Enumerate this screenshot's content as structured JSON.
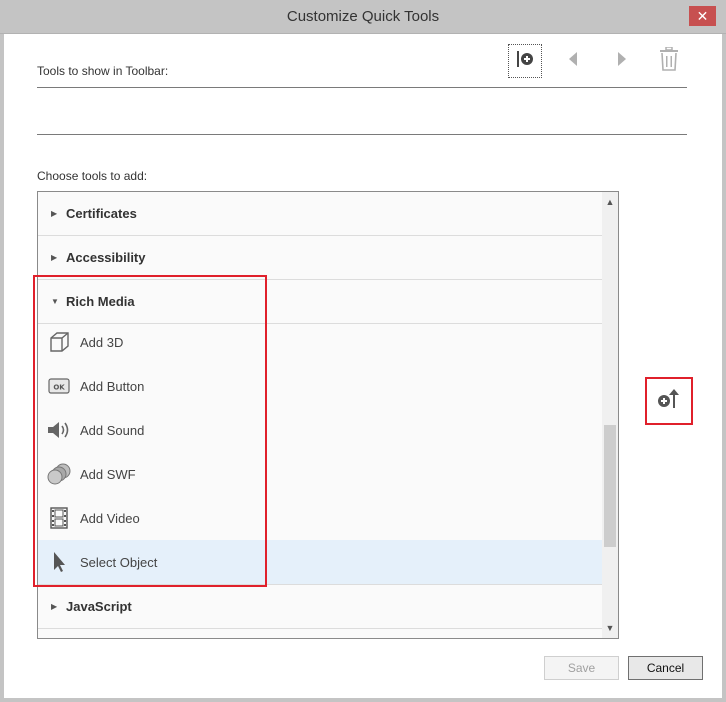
{
  "window": {
    "title": "Customize Quick Tools",
    "close_label": "✕"
  },
  "toolbar_section": {
    "label": "Tools to show in Toolbar:",
    "buttons": [
      {
        "name": "add-divider-button",
        "icon": "add-divider-icon"
      },
      {
        "name": "move-left-button",
        "icon": "triangle-left-icon"
      },
      {
        "name": "move-right-button",
        "icon": "triangle-right-icon"
      },
      {
        "name": "delete-button",
        "icon": "trash-icon"
      }
    ]
  },
  "choose_section": {
    "label": "Choose tools to add:",
    "categories": [
      {
        "label": "Certificates",
        "expanded": false
      },
      {
        "label": "Accessibility",
        "expanded": false
      },
      {
        "label": "Rich Media",
        "expanded": true
      },
      {
        "label": "JavaScript",
        "expanded": false
      }
    ],
    "rich_media_items": [
      {
        "label": "Add 3D",
        "icon": "cube-icon"
      },
      {
        "label": "Add Button",
        "icon": "ok-button-icon"
      },
      {
        "label": "Add Sound",
        "icon": "speaker-icon"
      },
      {
        "label": "Add SWF",
        "icon": "swf-discs-icon"
      },
      {
        "label": "Add Video",
        "icon": "film-strip-icon"
      },
      {
        "label": "Select Object",
        "icon": "cursor-arrow-icon",
        "selected": true
      }
    ],
    "add_to_toolbar_icon": "add-up-arrow-icon"
  },
  "footer": {
    "save_label": "Save",
    "cancel_label": "Cancel"
  },
  "colors": {
    "highlight": "#e0202b",
    "selected_row": "#e5f0fa"
  }
}
